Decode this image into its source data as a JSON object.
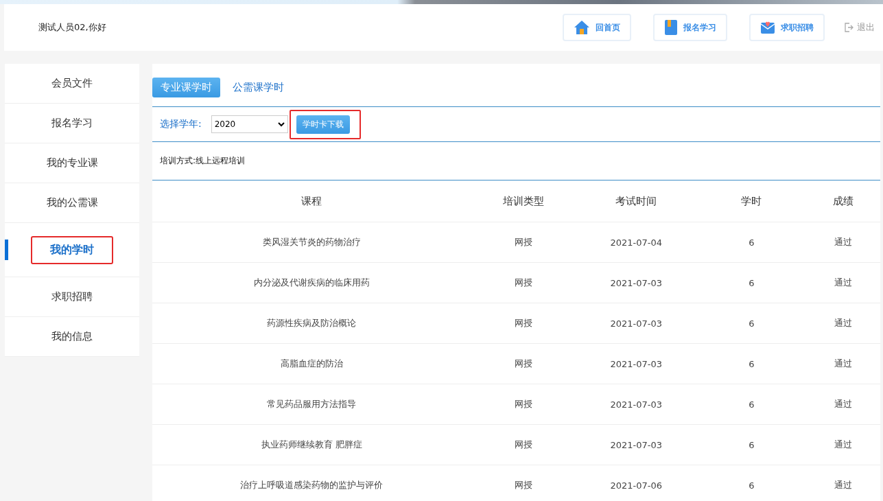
{
  "header": {
    "greeting": "测试人员02,你好",
    "nav": [
      {
        "kind": "home",
        "label": "回首页"
      },
      {
        "kind": "book",
        "label": "报名学习"
      },
      {
        "kind": "mail",
        "label": "求职招聘"
      }
    ],
    "logout": "退出"
  },
  "sidebar": {
    "items": [
      {
        "label": "会员文件",
        "selected": false,
        "highlighted": false
      },
      {
        "label": "报名学习",
        "selected": false,
        "highlighted": false
      },
      {
        "label": "我的专业课",
        "selected": false,
        "highlighted": false
      },
      {
        "label": "我的公需课",
        "selected": false,
        "highlighted": false
      },
      {
        "label": "我的学时",
        "selected": true,
        "highlighted": true
      },
      {
        "label": "求职招聘",
        "selected": false,
        "highlighted": false
      },
      {
        "label": "我的信息",
        "selected": false,
        "highlighted": false
      }
    ]
  },
  "tabs": [
    {
      "label": "专业课学时",
      "selected": true
    },
    {
      "label": "公需课学时",
      "selected": false
    }
  ],
  "filter": {
    "label": "选择学年:",
    "year": "2020",
    "download_button": {
      "label": "学时卡下载",
      "highlighted": true
    }
  },
  "training_mode": "培训方式:线上远程培训",
  "table": {
    "columns": [
      "课程",
      "培训类型",
      "考试时间",
      "学时",
      "成绩"
    ],
    "rows": [
      [
        "类风湿关节炎的药物治疗",
        "网授",
        "2021-07-04",
        "6",
        "通过"
      ],
      [
        "内分泌及代谢疾病的临床用药",
        "网授",
        "2021-07-03",
        "6",
        "通过"
      ],
      [
        "药源性疾病及防治概论",
        "网授",
        "2021-07-03",
        "6",
        "通过"
      ],
      [
        "高脂血症的防治",
        "网授",
        "2021-07-03",
        "6",
        "通过"
      ],
      [
        "常见药品服用方法指导",
        "网授",
        "2021-07-03",
        "6",
        "通过"
      ],
      [
        "执业药师继续教育 肥胖症",
        "网授",
        "2021-07-03",
        "6",
        "通过"
      ],
      [
        "治疗上呼吸道感染药物的监护与评价",
        "网授",
        "2021-07-06",
        "6",
        "通过"
      ]
    ]
  }
}
